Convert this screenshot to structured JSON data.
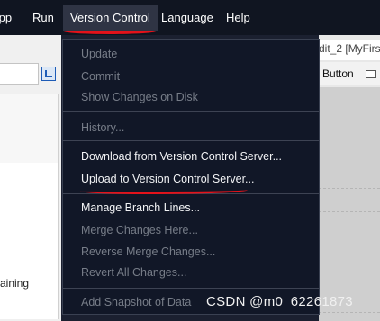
{
  "menubar": {
    "items": [
      {
        "label": "App"
      },
      {
        "label": "Run"
      },
      {
        "label": "Version Control",
        "active": true
      },
      {
        "label": "Language"
      },
      {
        "label": "Help"
      }
    ]
  },
  "background": {
    "title_fragment": "dit_2 [MyFirs",
    "toolbar_label": "Button",
    "left_text": "aining"
  },
  "dropdown": {
    "items": [
      {
        "label": "Update",
        "enabled": false
      },
      {
        "label": "Commit",
        "enabled": false
      },
      {
        "label": "Show Changes on Disk",
        "enabled": false
      },
      {
        "label": "History...",
        "enabled": false
      },
      {
        "label": "Download from Version Control Server...",
        "enabled": true
      },
      {
        "label": "Upload to Version Control Server...",
        "enabled": true,
        "highlighted": true
      },
      {
        "label": "Manage Branch Lines...",
        "enabled": true
      },
      {
        "label": "Merge Changes Here...",
        "enabled": false
      },
      {
        "label": "Reverse Merge Changes...",
        "enabled": false
      },
      {
        "label": "Revert All Changes...",
        "enabled": false
      },
      {
        "label": "Add Snapshot of Data",
        "enabled": false
      }
    ]
  },
  "watermark": "CSDN @m0_62261873",
  "colors": {
    "menu_bg": "#111727",
    "enabled_text": "#f2f3f5",
    "disabled_text": "#777d88",
    "annotation_red": "#e4121a"
  }
}
